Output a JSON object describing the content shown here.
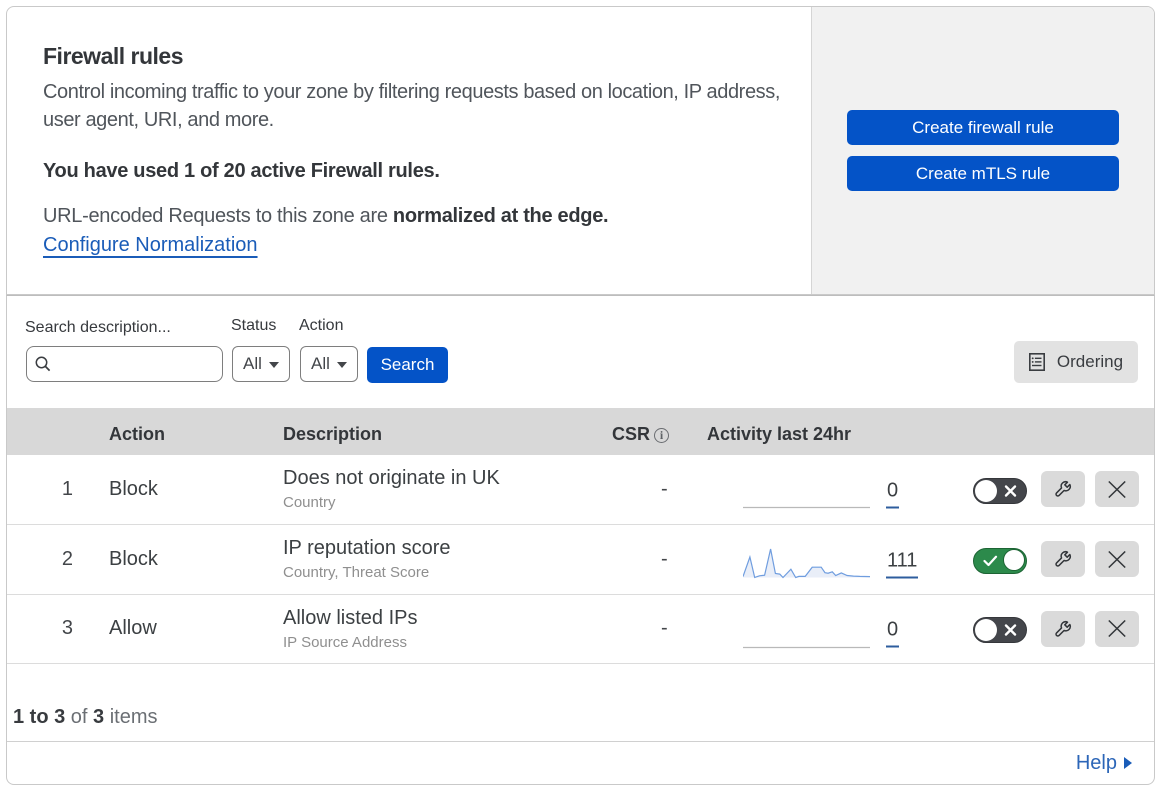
{
  "header": {
    "title": "Firewall rules",
    "description": "Control incoming traffic to your zone by filtering requests based on location, IP address, user agent, URI, and more.",
    "usage_statement": "You have used 1 of 20 active Firewall rules.",
    "normalization_prefix": "URL-encoded Requests to this zone are ",
    "normalization_bold": "normalized at the edge.",
    "normalization_link": "Configure Normalization",
    "create_firewall_button": "Create firewall rule",
    "create_mtls_button": "Create mTLS rule"
  },
  "filters": {
    "search_label": "Search description...",
    "search_value": "",
    "status_label": "Status",
    "status_value": "All",
    "action_label": "Action",
    "action_value": "All",
    "search_button": "Search",
    "ordering_button": "Ordering"
  },
  "table": {
    "columns": {
      "action": "Action",
      "description": "Description",
      "csr": "CSR",
      "activity": "Activity last 24hr"
    },
    "rows": [
      {
        "num": "1",
        "action": "Block",
        "description": "Does not originate in UK",
        "criteria": "Country",
        "csr": "-",
        "activity_count": "0",
        "enabled": false,
        "has_sparkline": false
      },
      {
        "num": "2",
        "action": "Block",
        "description": "IP reputation score",
        "criteria": "Country, Threat Score",
        "csr": "-",
        "activity_count": "111",
        "enabled": true,
        "has_sparkline": true
      },
      {
        "num": "3",
        "action": "Allow",
        "description": "Allow listed IPs",
        "criteria": "IP Source Address",
        "csr": "-",
        "activity_count": "0",
        "enabled": false,
        "has_sparkline": false
      }
    ]
  },
  "chart_data": {
    "type": "area",
    "title": "Activity last 24hr sparkline (rule 2)",
    "x": [
      0,
      5.4,
      9.2,
      13,
      17,
      21.7,
      25.5,
      29,
      31.5,
      37.7,
      41.5,
      44,
      49,
      54.5,
      61.6,
      64.6,
      67,
      70.3,
      73,
      77.4,
      82,
      87,
      92,
      100
    ],
    "values": [
      3,
      72,
      0,
      6,
      8,
      100,
      14,
      12,
      0,
      29,
      0,
      4,
      4,
      36,
      36,
      17,
      15,
      20,
      7,
      16,
      7,
      5,
      4,
      3
    ],
    "ylim": [
      0,
      100
    ],
    "line_color": "#6f9ddf",
    "fill_color": "#e9eef8"
  },
  "footer": {
    "range_text": "1 to 3",
    "of_text": " of ",
    "total_text": "3",
    "items_text": " items",
    "help_label": "Help"
  },
  "colors": {
    "primary_blue": "#0453c7",
    "link_blue": "#1759ba",
    "toggle_on_green": "#2c8a4b",
    "toggle_off_gray": "#43464d",
    "table_header_bg": "#d8d8d8",
    "panel_gray": "#f1f1f1"
  }
}
